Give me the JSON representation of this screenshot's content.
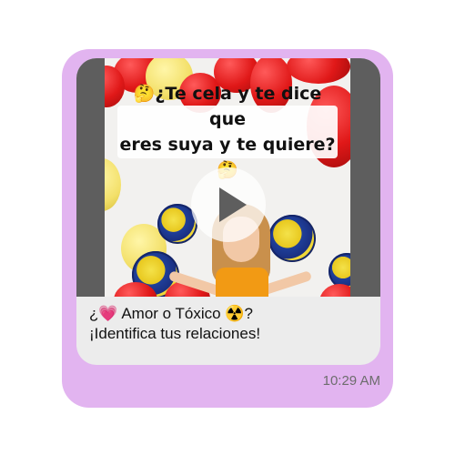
{
  "message": {
    "media": {
      "caption": "🤔¿Te cela y te dice que\neres suya y te quiere?🤔",
      "type": "video",
      "play_icon": "play-icon"
    },
    "text_line1": "¿💗 Amor o Tóxico ☢️?",
    "text_line2": "¡Identifica tus relaciones!",
    "time": "10:29 AM"
  },
  "colors": {
    "bubble": "#e2b4f0",
    "card": "#ececec",
    "letterbox": "#5e5e5e",
    "timestamp": "#6d6d6d"
  }
}
